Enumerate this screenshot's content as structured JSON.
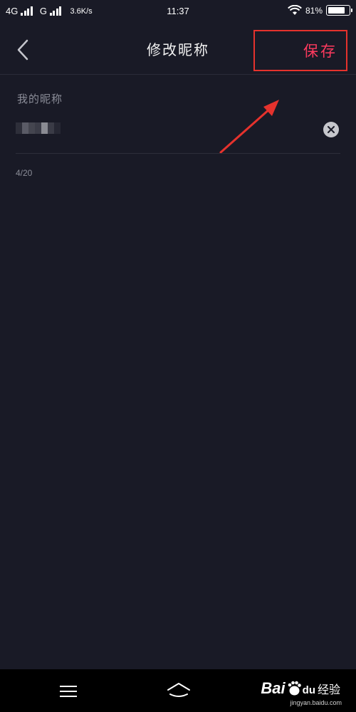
{
  "status_bar": {
    "network1": "4G",
    "network2": "G",
    "speed": "3.6K/s",
    "time": "11:37",
    "battery_text": "81%",
    "battery_level": 0.81,
    "icons": [
      "signal-icon",
      "signal-icon",
      "wifi-icon",
      "battery-icon"
    ]
  },
  "nav": {
    "back_icon": "chevron-left-icon",
    "title": "修改昵称",
    "save_label": "保存"
  },
  "form": {
    "label": "我的昵称",
    "nickname_value": "",
    "nickname_obscured": true,
    "clear_icon": "clear-circle-icon",
    "char_count": "4/20"
  },
  "system_nav": {
    "icons": [
      "menu-icon",
      "home-icon"
    ]
  },
  "watermark": {
    "brand_bai": "Bai",
    "brand_du": "du",
    "brand_suffix": "经验",
    "url": "jingyan.baidu.com"
  },
  "colors": {
    "background": "#191a26",
    "save_text": "#fe3a5e",
    "highlight_border": "#e5322d",
    "label_text": "#8b8d98"
  }
}
